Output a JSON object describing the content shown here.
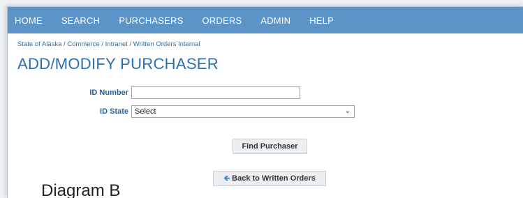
{
  "nav": {
    "items": [
      "HOME",
      "SEARCH",
      "PURCHASERS",
      "ORDERS",
      "ADMIN",
      "HELP"
    ]
  },
  "breadcrumb": "State of Alaska / Commerce / Intranet / Written Orders Internal",
  "title": "ADD/MODIFY PURCHASER",
  "form": {
    "id_number_label": "ID Number",
    "id_number_value": "",
    "id_state_label": "ID State",
    "id_state_selected": "Select",
    "find_button": "Find Purchaser",
    "back_button": "Back to Written Orders"
  },
  "caption": "Diagram B",
  "colors": {
    "nav_bg": "#5d94c8",
    "accent": "#2a6db0"
  }
}
